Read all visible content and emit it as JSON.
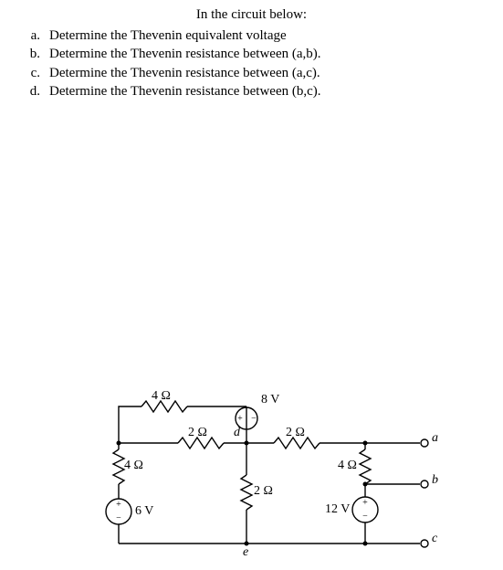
{
  "header": "In the circuit below:",
  "questions": [
    {
      "letter": "a.",
      "text": "Determine the Thevenin equivalent voltage"
    },
    {
      "letter": "b.",
      "text": "Determine the Thevenin resistance between (a,b)."
    },
    {
      "letter": "c.",
      "text": "Determine the Thevenin resistance between (a,c)."
    },
    {
      "letter": "d.",
      "text": "Determine the Thevenin resistance between (b,c)."
    }
  ],
  "circuit": {
    "components": {
      "r_top_left": "4 Ω",
      "r_mid_left": "2 Ω",
      "r_left_vert": "4 Ω",
      "r_center_vert": "2 Ω",
      "r_mid_right": "2 Ω",
      "r_right_vert": "4 Ω",
      "v_top": "8 V",
      "v_left": "6 V",
      "v_right": "12 V"
    },
    "nodes": {
      "a": "a",
      "b": "b",
      "c": "c",
      "d": "d",
      "e": "e"
    },
    "src_signs": {
      "plus": "+",
      "minus": "−"
    }
  }
}
